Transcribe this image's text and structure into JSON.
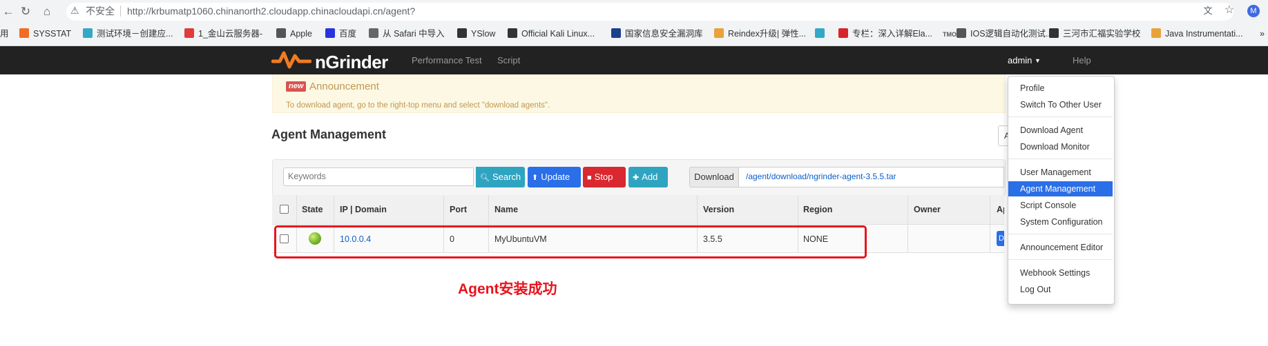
{
  "browser": {
    "insecure_label": "不安全",
    "url": "http://krbumatp1060.chinanorth2.cloudapp.chinacloudapi.cn/agent?",
    "profile_initial": "M"
  },
  "bookmarks": [
    {
      "label": "用",
      "color": "#ffffff"
    },
    {
      "label": "SYSSTAT",
      "color": "#f36c21"
    },
    {
      "label": "测试环境－创建应...",
      "color": "#34a8c7"
    },
    {
      "label": "1_金山云服务器-",
      "color": "#e23b3b"
    },
    {
      "label": "Apple",
      "color": "#555555"
    },
    {
      "label": "百度",
      "color": "#2932e1"
    },
    {
      "label": "从 Safari 中导入",
      "color": "#666666"
    },
    {
      "label": "YSlow",
      "color": "#333333"
    },
    {
      "label": "Official Kali Linux...",
      "color": "#333333"
    },
    {
      "label": "国家信息安全漏洞库",
      "color": "#1d3f8f"
    },
    {
      "label": "Reindex升级| 弹性...",
      "color": "#e9a23b"
    },
    {
      "label": "",
      "color": "#34a8c7"
    },
    {
      "label": "专栏：深入详解Ela...",
      "color": "#d8232a"
    },
    {
      "label": "IOS逻辑自动化测试...",
      "color": "#555555"
    },
    {
      "label": "三河市汇福实验学校",
      "color": "#333333"
    },
    {
      "label": "Java Instrumentati...",
      "color": "#e9a23b"
    }
  ],
  "bookmarks_overflow": "»",
  "tmo_label": "TMO",
  "navbar": {
    "logo_text": "nGrinder",
    "links": [
      "Performance Test",
      "Script"
    ],
    "admin": "admin",
    "help": "Help"
  },
  "announcement": {
    "badge": "new",
    "title": "Announcement",
    "text": "To download agent, go to the right-top menu and select \"download agents\"."
  },
  "page": {
    "title": "Agent Management",
    "title_right_btn": "A"
  },
  "toolbar": {
    "search_placeholder": "Keywords",
    "search_label": "Search",
    "update_label": "Update",
    "stop_label": "Stop",
    "add_label": "Add",
    "download_label": "Download",
    "download_link": "/agent/download/ngrinder-agent-3.5.5.tar"
  },
  "table": {
    "headers": [
      "State",
      "IP | Domain",
      "Port",
      "Name",
      "Version",
      "Region",
      "Owner",
      "Ap"
    ],
    "rows": [
      {
        "ip": "10.0.0.4",
        "port": "0",
        "name": "MyUbuntuVM",
        "version": "3.5.5",
        "region": "NONE",
        "owner": "",
        "approve": "Di"
      }
    ]
  },
  "annotation": "Agent安装成功",
  "dropdown": {
    "groups": [
      [
        "Profile",
        "Switch To Other User"
      ],
      [
        "Download Agent",
        "Download Monitor"
      ],
      [
        "User Management",
        "Agent Management",
        "Script Console",
        "System Configuration"
      ],
      [
        "Announcement Editor"
      ],
      [
        "Webhook Settings",
        "Log Out"
      ]
    ],
    "active": "Agent Management"
  },
  "colors": {
    "navbar": "#222222",
    "primary": "#2a6ee8",
    "info": "#2fa4c1",
    "danger": "#d9282f",
    "annotation": "#e8131c",
    "announcement_bg": "#fcf8e3"
  }
}
